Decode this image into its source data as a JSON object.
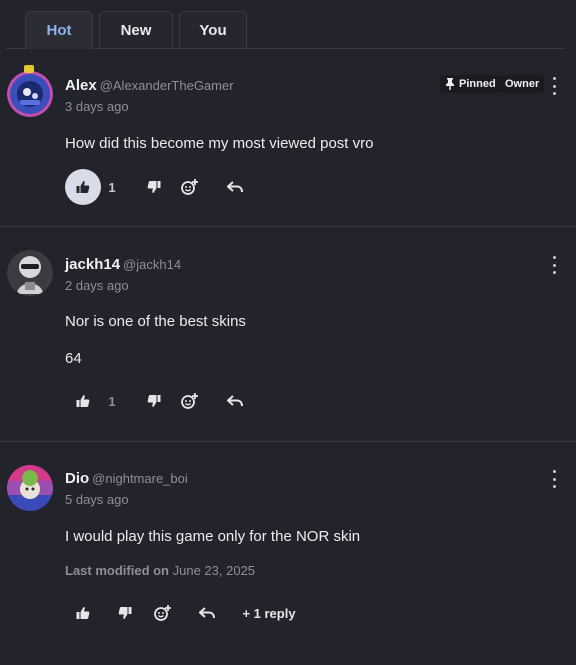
{
  "tabs": [
    {
      "label": "Hot",
      "active": true
    },
    {
      "label": "New",
      "active": false
    },
    {
      "label": "You",
      "active": false
    }
  ],
  "comments": [
    {
      "author": "Alex",
      "handle": "@AlexanderTheGamer",
      "time": "3 days ago",
      "text": "How did this become my most viewed post vro",
      "badges": {
        "pinned": "Pinned",
        "owner": "Owner"
      },
      "likes": "1",
      "liked": true
    },
    {
      "author": "jackh14",
      "handle": "@jackh14",
      "time": "2 days ago",
      "text": "Nor is one of the best skins",
      "text2": "64",
      "likes": "1",
      "liked": false
    },
    {
      "author": "Dio",
      "handle": "@nightmare_boi",
      "time": "5 days ago",
      "text": "I would play this game only for the NOR skin",
      "modified_label": "Last modified on",
      "modified_date": "June 23, 2025",
      "replies": "+ 1 reply"
    }
  ],
  "colors": {
    "background": "#23232b",
    "active_tab": "#8fb3ea",
    "liked_bg": "#d9dbe8"
  },
  "icons": [
    "thumbs-up-icon",
    "thumbs-down-icon",
    "emoji-add-icon",
    "reply-icon",
    "pin-icon",
    "more-vertical-icon"
  ]
}
